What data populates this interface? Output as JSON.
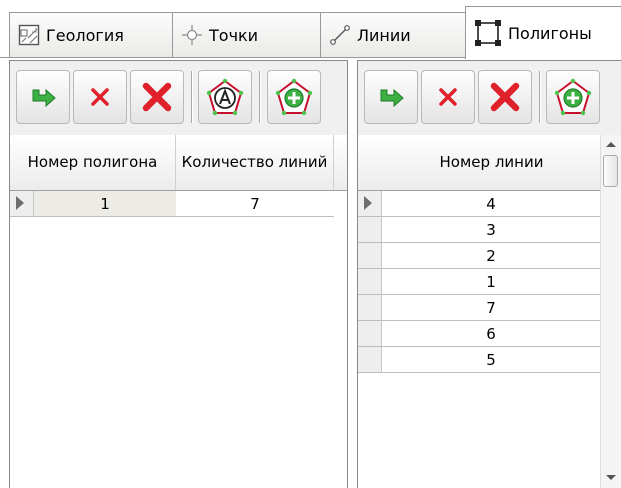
{
  "tabs": [
    {
      "label": "Геология",
      "icon": "geology-map-icon",
      "active": false
    },
    {
      "label": "Точки",
      "icon": "crosshair-point-icon",
      "active": false
    },
    {
      "label": "Линии",
      "icon": "polyline-icon",
      "active": false
    },
    {
      "label": "Полигоны",
      "icon": "polygon-square-icon",
      "active": true
    }
  ],
  "left_panel": {
    "toolbar": [
      "apply-arrow-icon",
      "delete-x-icon",
      "delete-all-x-icon",
      "polygon-label-a-icon",
      "polygon-add-icon"
    ],
    "columns": [
      {
        "label": "Номер полигона"
      },
      {
        "label": "Количество линий"
      }
    ],
    "rows": [
      {
        "number": "1",
        "count": "7",
        "selected": true
      }
    ]
  },
  "right_panel": {
    "toolbar": [
      "apply-arrow-icon",
      "delete-x-icon",
      "delete-all-x-icon",
      "polygon-add-icon"
    ],
    "column_label": "Номер линии",
    "rows": [
      "4",
      "3",
      "2",
      "1",
      "7",
      "6",
      "5"
    ]
  },
  "colors": {
    "accent_green": "#3cb043",
    "delete_red": "#e0202a",
    "polygon_red": "#c8102e"
  }
}
